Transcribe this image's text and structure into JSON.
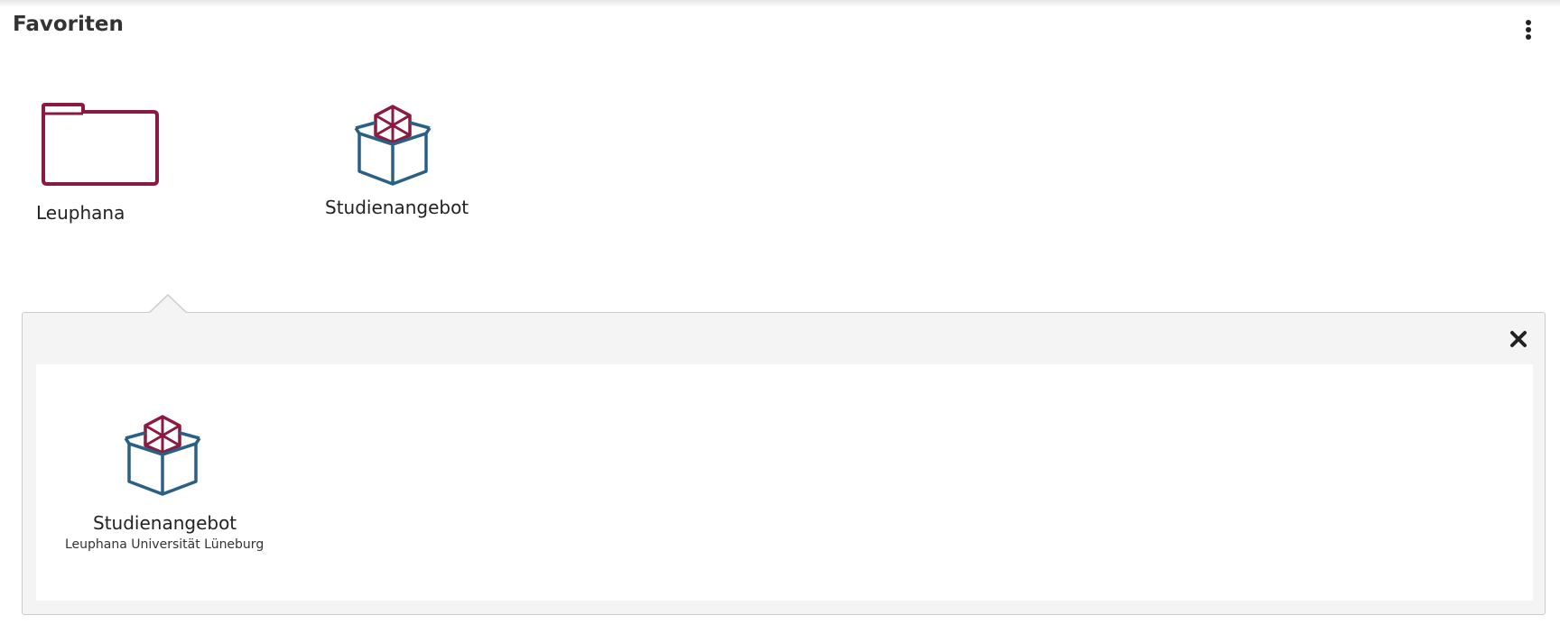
{
  "header": {
    "title": "Favoriten",
    "menu_icon": "vertical-ellipsis-icon"
  },
  "favorites": [
    {
      "label": "Leuphana",
      "icon": "folder-icon"
    },
    {
      "label": "Studienangebot",
      "icon": "package-box-icon"
    }
  ],
  "panel": {
    "close_icon": "close-icon",
    "items": [
      {
        "label": "Studienangebot",
        "sublabel": "Leuphana Universität Lüneburg",
        "icon": "package-box-icon"
      }
    ]
  },
  "colors": {
    "folder": "#8b1a3f",
    "box_top": "#8b1a3f",
    "box_body": "#2a5f86",
    "panel_bg": "#f4f4f4"
  }
}
